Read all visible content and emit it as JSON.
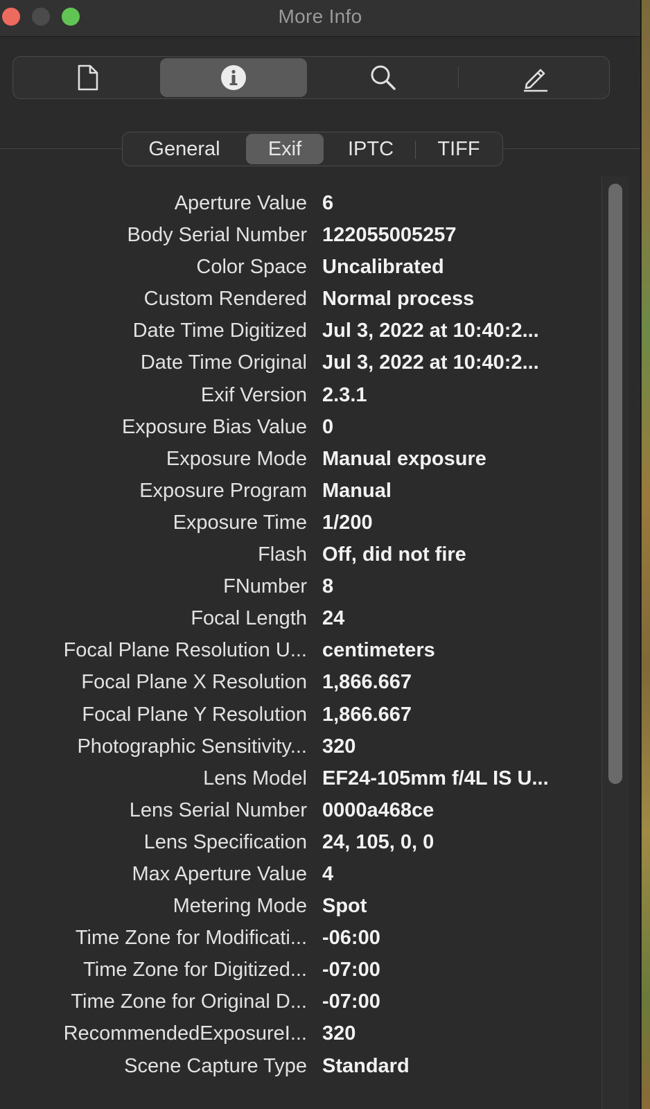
{
  "window": {
    "title": "More Info"
  },
  "toolbar": {
    "items": [
      {
        "icon": "document-icon",
        "selected": false
      },
      {
        "icon": "info-icon",
        "selected": true
      },
      {
        "icon": "magnifier-icon",
        "selected": false
      },
      {
        "icon": "pencil-icon",
        "selected": false
      }
    ]
  },
  "tabs": [
    {
      "label": "General",
      "selected": false
    },
    {
      "label": "Exif",
      "selected": true
    },
    {
      "label": "IPTC",
      "selected": false
    },
    {
      "label": "TIFF",
      "selected": false
    }
  ],
  "rows": [
    {
      "key": "Aperture Value",
      "value": "6"
    },
    {
      "key": "Body Serial Number",
      "value": "122055005257"
    },
    {
      "key": "Color Space",
      "value": "Uncalibrated"
    },
    {
      "key": "Custom Rendered",
      "value": "Normal process"
    },
    {
      "key": "Date Time Digitized",
      "value": "Jul 3, 2022 at 10:40:2..."
    },
    {
      "key": "Date Time Original",
      "value": "Jul 3, 2022 at 10:40:2..."
    },
    {
      "key": "Exif Version",
      "value": "2.3.1"
    },
    {
      "key": "Exposure Bias Value",
      "value": "0"
    },
    {
      "key": "Exposure Mode",
      "value": "Manual exposure"
    },
    {
      "key": "Exposure Program",
      "value": "Manual"
    },
    {
      "key": "Exposure Time",
      "value": "1/200"
    },
    {
      "key": "Flash",
      "value": "Off, did not fire"
    },
    {
      "key": "FNumber",
      "value": "8"
    },
    {
      "key": "Focal Length",
      "value": "24"
    },
    {
      "key": "Focal Plane Resolution U...",
      "value": "centimeters"
    },
    {
      "key": "Focal Plane X Resolution",
      "value": "1,866.667"
    },
    {
      "key": "Focal Plane Y Resolution",
      "value": "1,866.667"
    },
    {
      "key": "Photographic Sensitivity...",
      "value": "320"
    },
    {
      "key": "Lens Model",
      "value": "EF24-105mm f/4L IS U..."
    },
    {
      "key": "Lens Serial Number",
      "value": "0000a468ce"
    },
    {
      "key": "Lens Specification",
      "value": "24, 105, 0, 0"
    },
    {
      "key": "Max Aperture Value",
      "value": "4"
    },
    {
      "key": "Metering Mode",
      "value": "Spot"
    },
    {
      "key": "Time Zone for Modificati...",
      "value": "-06:00"
    },
    {
      "key": "Time Zone for Digitized...",
      "value": "-07:00"
    },
    {
      "key": "Time Zone for Original D...",
      "value": "-07:00"
    },
    {
      "key": "RecommendedExposureI...",
      "value": "320"
    },
    {
      "key": "Scene Capture Type",
      "value": "Standard"
    }
  ],
  "colors": {
    "close": "#ed6a5e",
    "minimize_inactive": "#4b4b4b",
    "zoom": "#61c554",
    "selected_segment": "#5a5a5a"
  }
}
